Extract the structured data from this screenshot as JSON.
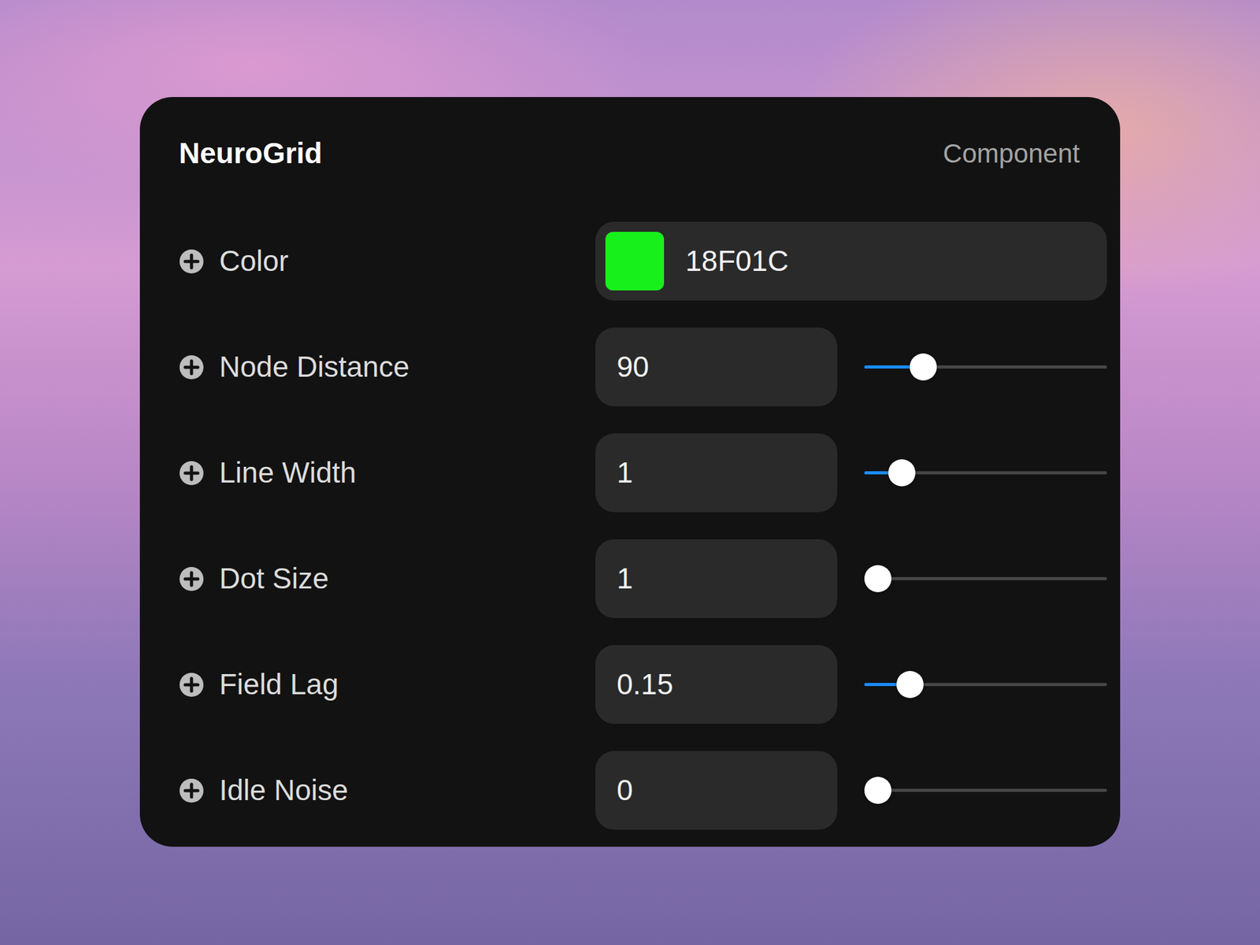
{
  "panel": {
    "title": "NeuroGrid",
    "subtitle": "Component"
  },
  "properties": [
    {
      "label": "Color",
      "kind": "color",
      "value": "18F01C",
      "color": "#18F01C"
    },
    {
      "label": "Node Distance",
      "kind": "slider",
      "value": "90",
      "level": 0.21
    },
    {
      "label": "Line Width",
      "kind": "slider",
      "value": "1",
      "level": 0.11
    },
    {
      "label": "Dot Size",
      "kind": "slider",
      "value": "1",
      "level": 0
    },
    {
      "label": "Field Lag",
      "kind": "slider",
      "value": "0.15",
      "level": 0.15
    },
    {
      "label": "Idle Noise",
      "kind": "slider",
      "value": "0",
      "level": 0
    }
  ]
}
